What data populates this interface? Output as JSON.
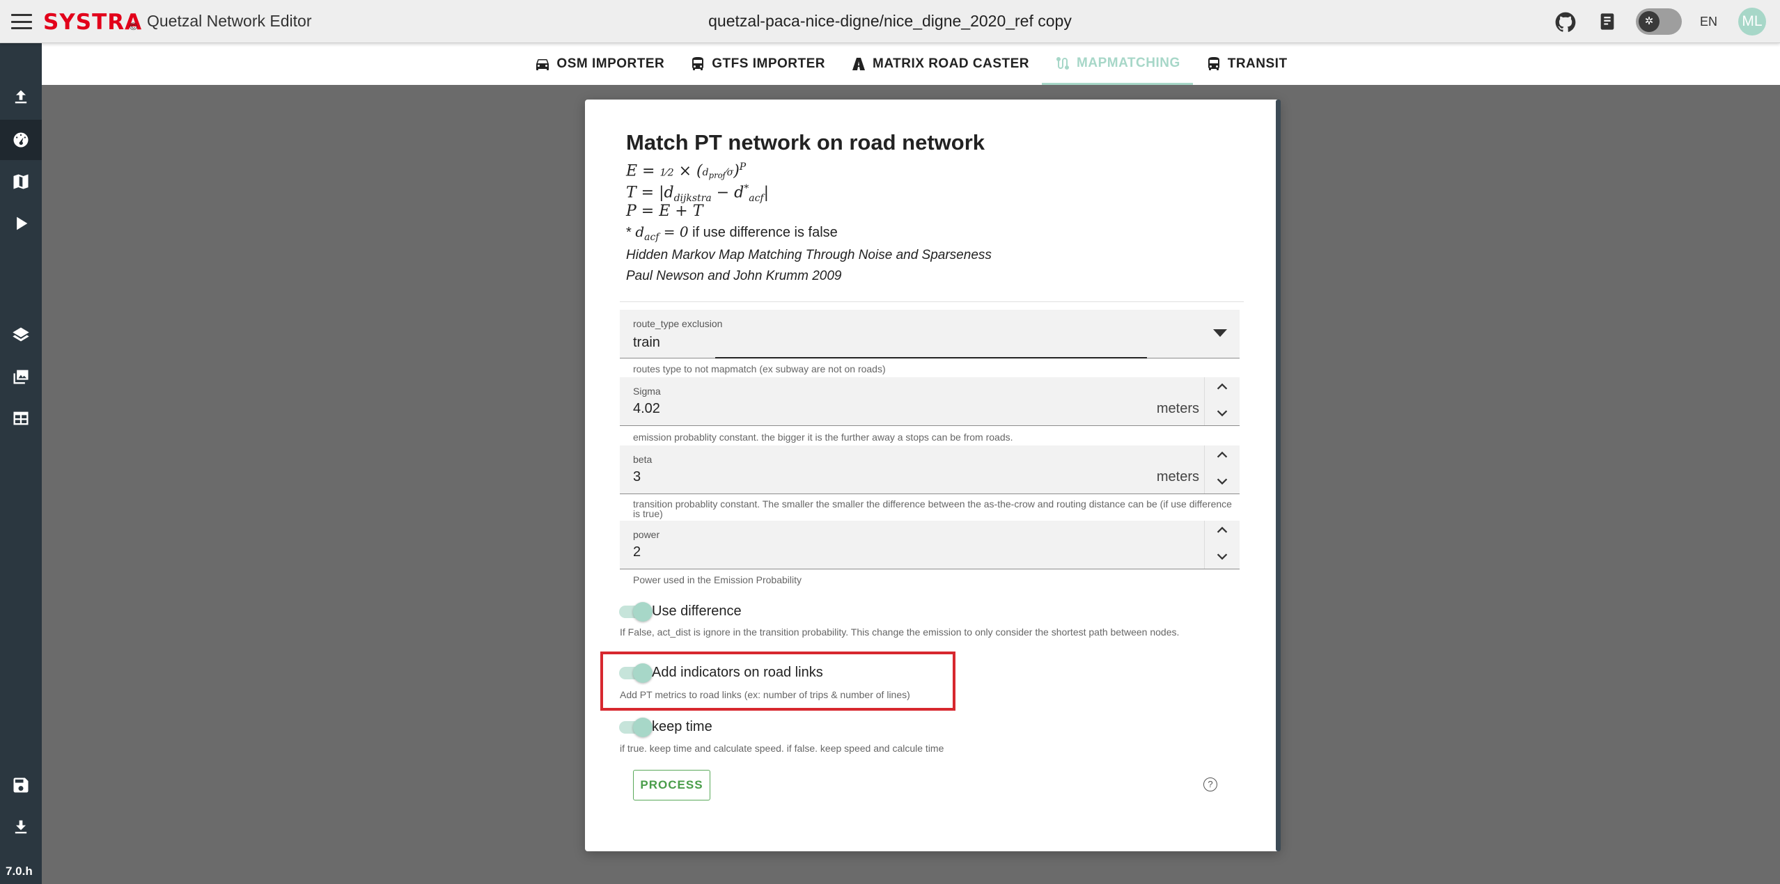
{
  "header": {
    "logo": "SYSTRA",
    "copyright": "©",
    "app_title": "Quetzal Network Editor",
    "project_title": "quetzal-paca-nice-digne/nice_digne_2020_ref copy",
    "language": "EN",
    "avatar_initials": "ML",
    "theme_toggle_icon": "✲"
  },
  "sidebar": {
    "items": [
      "upload-icon",
      "dashboard-icon",
      "map-icon",
      "play-icon",
      "layers-icon",
      "gallery-icon",
      "table-icon",
      "save-icon",
      "download-icon"
    ],
    "active": "dashboard-icon",
    "version": "7.0.h"
  },
  "tabs": [
    {
      "label": "OSM IMPORTER",
      "icon": "car-icon"
    },
    {
      "label": "GTFS IMPORTER",
      "icon": "bus-icon"
    },
    {
      "label": "MATRIX ROAD CASTER",
      "icon": "road-icon"
    },
    {
      "label": "MAPMATCHING",
      "icon": "route-icon",
      "active": true
    },
    {
      "label": "TRANSIT",
      "icon": "bus-icon"
    }
  ],
  "dialog": {
    "title": "Match PT network on road network",
    "note_prefix": "*",
    "note_text": "if use difference is false",
    "reference_title": "Hidden Markov Map Matching Through Noise and Sparseness",
    "reference_authors": "Paul Newson and John Krumm 2009",
    "route_type": {
      "label": "route_type exclusion",
      "value": "train",
      "hint": "routes type to not mapmatch (ex subway are not on roads)"
    },
    "sigma": {
      "label": "Sigma",
      "value": "4.02",
      "unit": "meters",
      "hint": "emission probablity constant. the bigger it is the further away a stops can be from roads."
    },
    "beta": {
      "label": "beta",
      "value": "3",
      "unit": "meters",
      "hint": "transition probablity constant. The smaller the smaller the difference between the as-the-crow and routing distance can be (if use difference is true)"
    },
    "power": {
      "label": "power",
      "value": "2",
      "hint": "Power used in the Emission Probability"
    },
    "use_difference": {
      "label": "Use difference",
      "checked": true,
      "hint": "If False, act_dist is ignore in the transition probability. This change the emission to only consider the shortest path between nodes."
    },
    "add_indicators": {
      "label": "Add indicators on road links",
      "checked": true,
      "hint": "Add PT metrics to road links (ex: number of trips & number of lines)"
    },
    "keep_time": {
      "label": "keep time",
      "checked": true,
      "hint": "if true. keep time and calculate speed. if false. keep speed and calcule time"
    },
    "process_label": "PROCESS",
    "help_icon": "?"
  },
  "colors": {
    "accent": "#a7d7c8",
    "highlight": "#d7282f",
    "brand": "#e2001a",
    "sidebar": "#2b3740",
    "process": "#4a9d4a"
  }
}
